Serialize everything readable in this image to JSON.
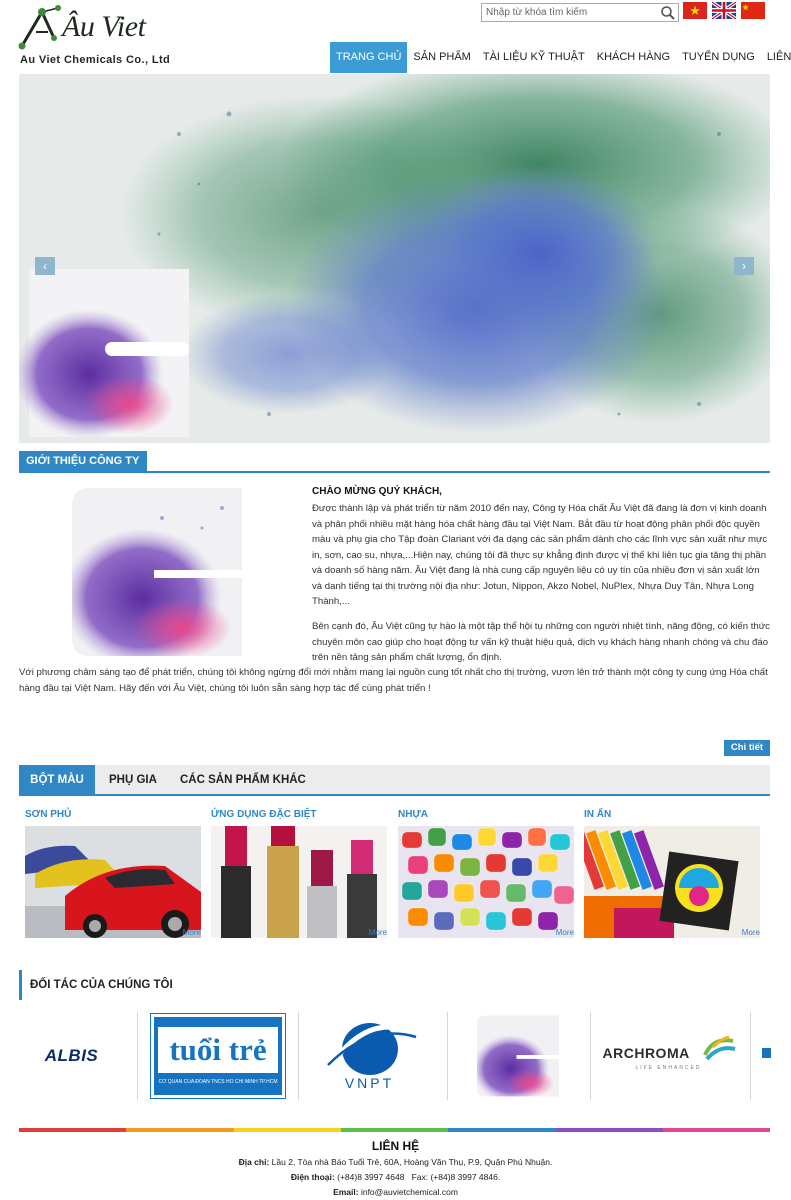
{
  "header": {
    "logo_text": "Âu Viet",
    "logo_sub": "Au Viet Chemicals Co., Ltd",
    "search_placeholder": "Nhập từ khóa tìm kiếm",
    "flags": [
      "vietnam-flag",
      "uk-flag",
      "china-flag"
    ]
  },
  "nav": {
    "items": [
      "TRANG CHỦ",
      "SẢN PHẨM",
      "TÀI LIỆU KỸ THUẬT",
      "KHÁCH HÀNG",
      "TUYỂN DỤNG",
      "LIÊN HỆ"
    ],
    "active_index": 0
  },
  "slider": {
    "prev": "‹",
    "next": "›"
  },
  "intro": {
    "section_title": "GIỚI THIỆU CÔNG TY",
    "title": "CHÀO MỪNG QUÝ KHÁCH,",
    "p1": "Được thành lập và phát triển từ năm 2010 đến nay, Công ty Hóa chất Âu Việt đã đang là đơn vị kinh doanh và phân phối nhiều mặt hàng hóa chất hàng đầu tại Việt Nam. Bắt đầu từ hoạt động phân phối độc quyền màu và phụ gia cho Tập đoàn Clariant với đa dạng các sản phẩm dành cho các lĩnh vực sản xuất như mực in, sơn, cao su, nhựa,...Hiện nay, chúng tôi đã thực sự khẳng định được vị thế khi liên tục gia tăng thị phần và doanh số hàng năm. Âu Việt đang là nhà cung cấp nguyên liệu có uy tín của nhiều đơn vị sản xuất lớn và danh tiếng tại thị trường nội địa như: Jotun, Nippon, Akzo Nobel, NuPlex, Nhựa Duy Tân, Nhựa Long Thành,...",
    "p2": "Bên cạnh đó, Âu Việt cũng tự hào là một tập thể hội tụ những con người nhiệt tình, năng động, có kiến thức chuyên môn cao giúp cho hoạt động tư vấn kỹ thuật hiệu quả, dịch vụ khách hàng nhanh chóng và chu đáo trên nền tảng sản phẩm chất lượng, ổn định.",
    "p3": "Với phương châm sáng tạo để phát triển, chúng tôi không ngừng đổi mới nhằm mang lại nguồn cung tốt nhất cho thị trường, vươn lên trở thành một công ty cung ứng Hóa chất hàng đầu tại Việt Nam. Hãy đến với  Âu Việt, chúng tôi luôn sẵn sàng hợp tác để cùng phát triển !",
    "detail_button": "Chi tiết"
  },
  "products": {
    "tabs": [
      "BỘT MÀU",
      "PHỤ GIA",
      "CÁC SẢN PHẨM KHÁC"
    ],
    "active_tab": 0,
    "categories": [
      {
        "title": "SƠN PHỦ",
        "more": "More"
      },
      {
        "title": "ỨNG DỤNG ĐẶC BIỆT",
        "more": "More"
      },
      {
        "title": "NHỰA",
        "more": "More"
      },
      {
        "title": "IN ẤN",
        "more": "More"
      }
    ]
  },
  "partners": {
    "title": "ĐỐI TÁC CỦA CHÚNG TÔI",
    "logos": [
      "ALBIS",
      "tuổi trẻ",
      "VNPT",
      "ARCHROMA"
    ],
    "tuoitre_caption": "CƠ QUAN CỦA ĐOÀN TNCS HỒ CHÍ MINH TP.HCM",
    "archroma_tag": "LIFE ENHANCED"
  },
  "footer": {
    "title": "LIÊN HỆ",
    "address_label": "Địa chỉ:",
    "address": "Lầu 2, Tòa nhà Báo Tuổi Trẻ, 60A, Hoàng Văn Thụ, P.9, Quận Phú Nhuận.",
    "phone_label": "Điện thoại:",
    "phone": "(+84)8 3997 4648",
    "fax_label": "Fax:",
    "fax": "(+84)8 3997 4846.",
    "email_label": "Email:",
    "email": "info@auvietchemical.com",
    "stripe_colors": [
      "#e23b3b",
      "#f39a1e",
      "#f3d21e",
      "#5bbf4a",
      "#2f87c6",
      "#8a4fc2",
      "#e0488f"
    ]
  },
  "colors": {
    "accent": "#2f87c6",
    "nav_active": "#3a9bd5"
  }
}
